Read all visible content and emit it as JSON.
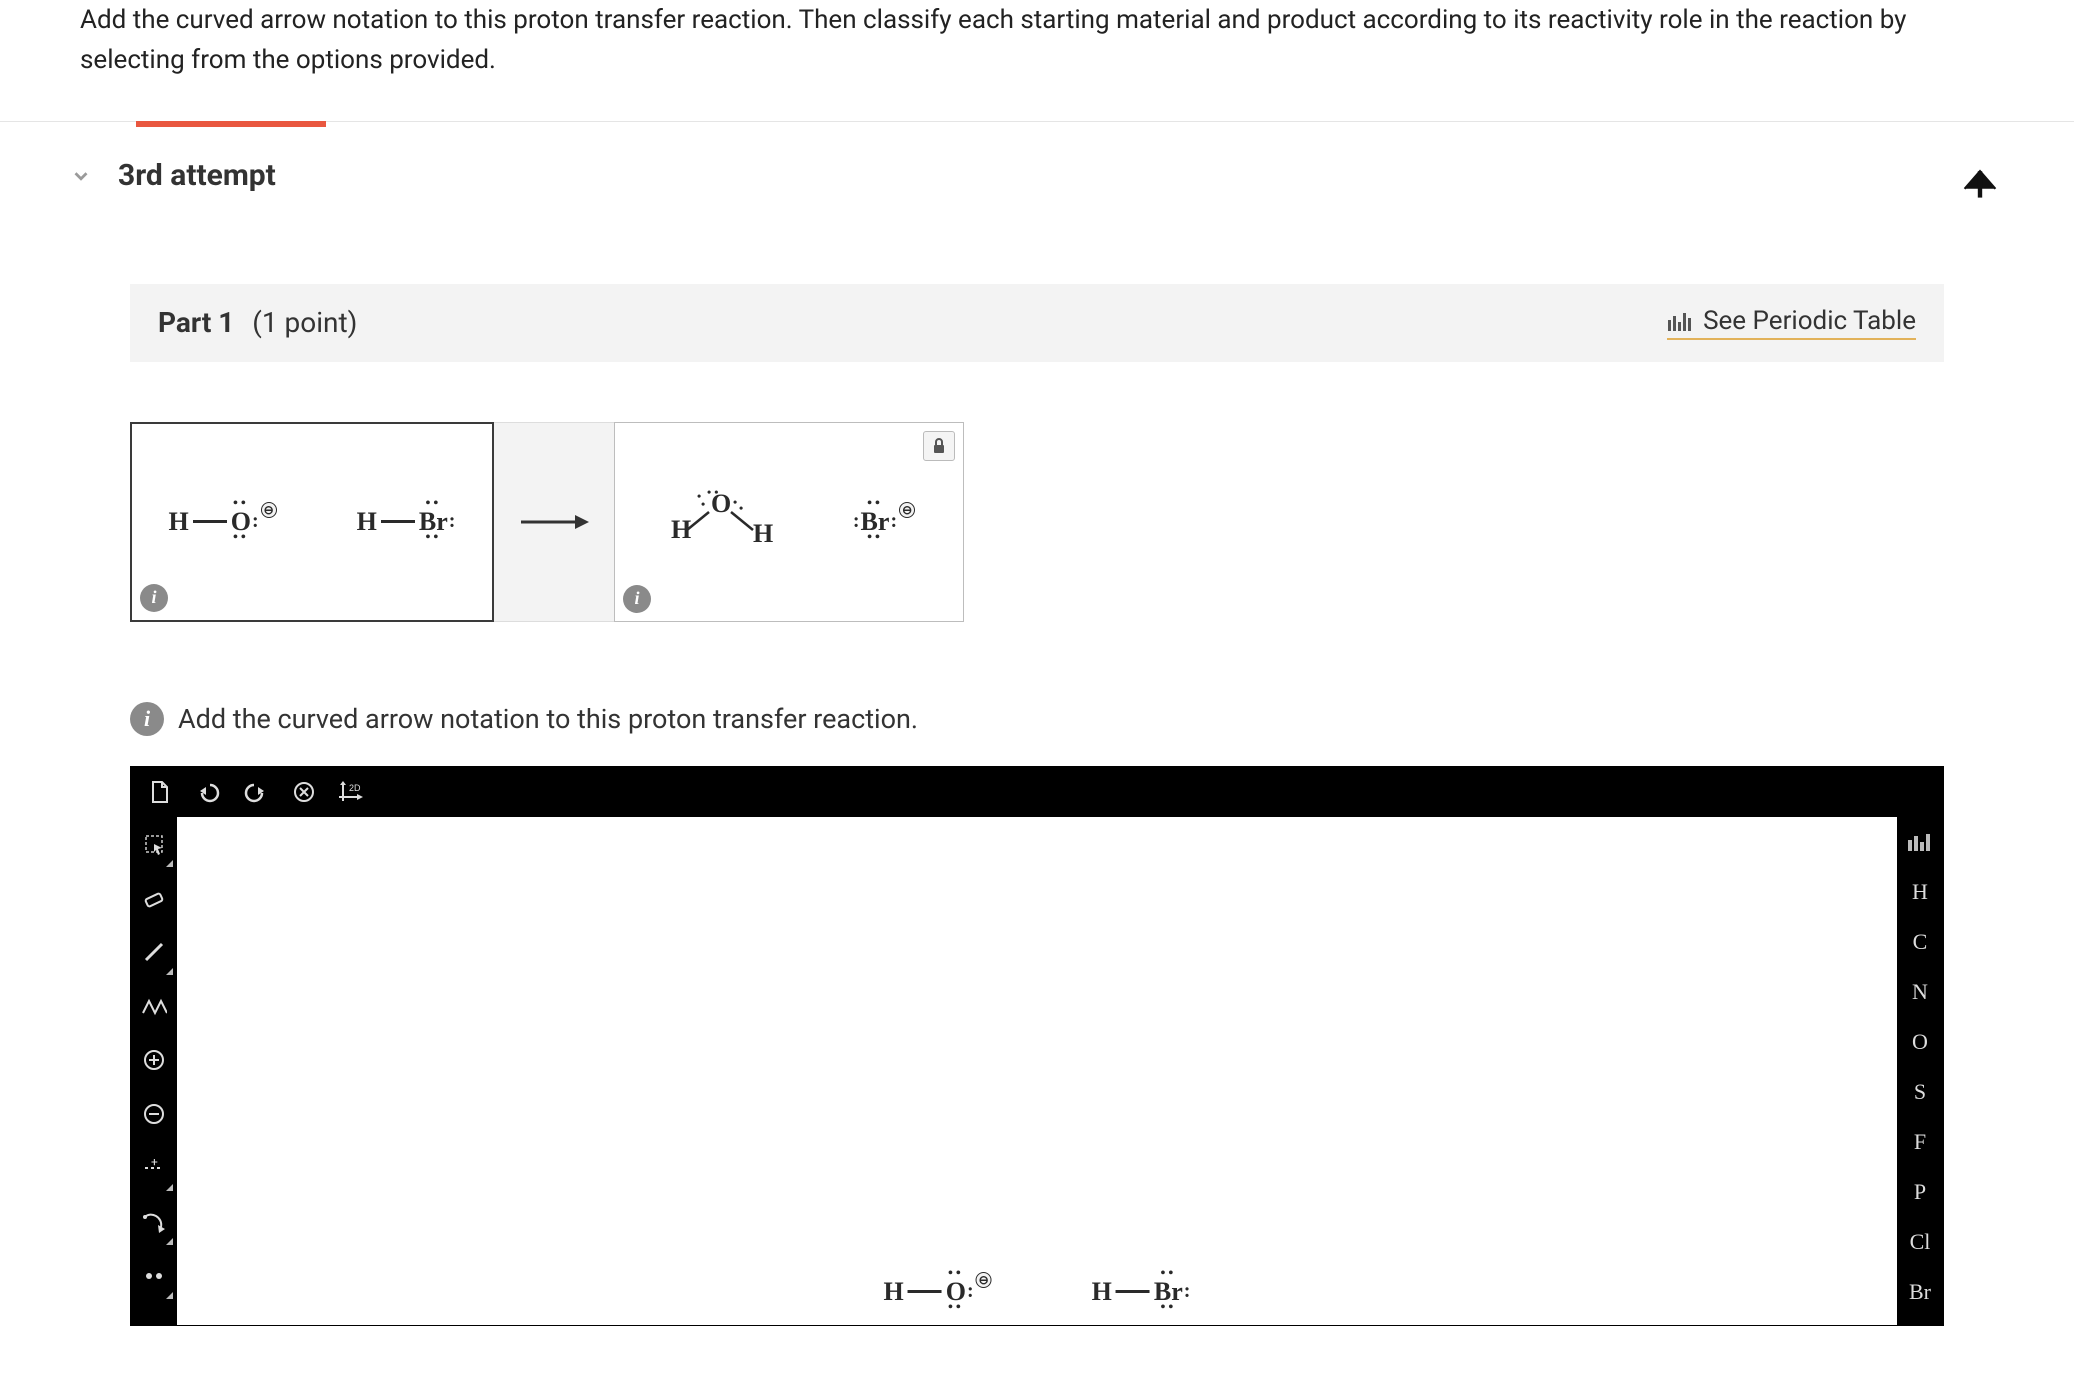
{
  "question": "Add the curved arrow notation to this proton transfer reaction. Then classify each starting material and product according to its reactivity role in the reaction by selecting from the options provided.",
  "attempt": {
    "label": "3rd attempt"
  },
  "part": {
    "title": "Part 1",
    "points": "(1 point)"
  },
  "periodic": {
    "label": "See Periodic Table"
  },
  "instruction": "Add the curved arrow notation to this proton transfer reaction.",
  "reactants": {
    "left": {
      "text_h": "H",
      "text_o": "O",
      "charge": "⊖"
    },
    "right": {
      "text_h": "H",
      "text_br": "Br"
    }
  },
  "products": {
    "h2o": {
      "left_h": "H",
      "center_o": "O",
      "right_h": "H"
    },
    "br": {
      "text_br": "Br",
      "charge": "⊖"
    }
  },
  "editor_top": {
    "new": "new-file-icon",
    "undo": "undo-icon",
    "redo": "redo-icon",
    "clear": "clear-icon",
    "view2d": "2D"
  },
  "editor_left": [
    "select-icon",
    "eraser-icon",
    "bond-icon",
    "wavy-bond-icon",
    "plus-circle-icon",
    "minus-circle-icon",
    "lone-pair-icon",
    "arrow-icon",
    "curved-arrow-icon",
    "lone-pair-dots-icon"
  ],
  "editor_right": {
    "top": "periodic-mini-icon",
    "elements": [
      "H",
      "C",
      "N",
      "O",
      "S",
      "F",
      "P",
      "Cl",
      "Br"
    ]
  },
  "canvas": {
    "mol1": {
      "h": "H",
      "o": "O",
      "charge": "⊖"
    },
    "mol2": {
      "h": "H",
      "br": "Br"
    }
  }
}
